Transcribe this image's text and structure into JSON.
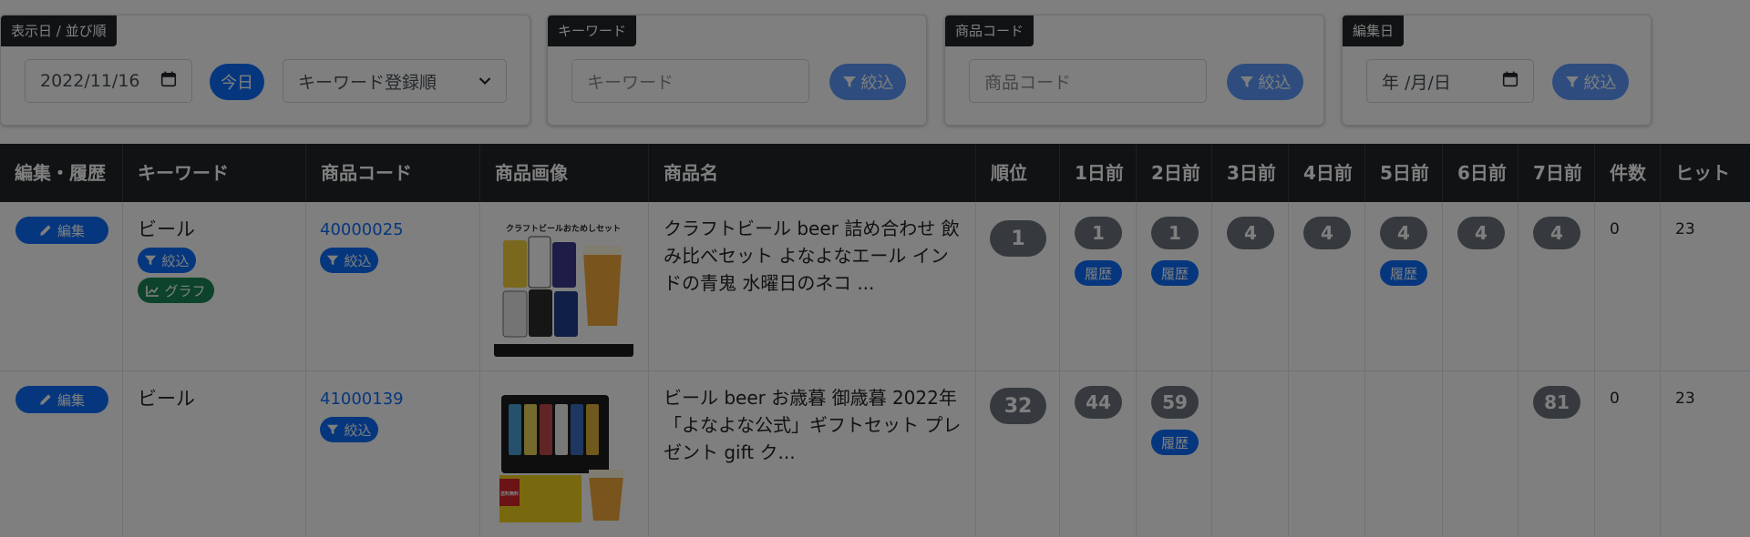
{
  "filters": {
    "date_sort": {
      "tag": "表示日 / 並び順",
      "date_value": "2022/11/16",
      "today_label": "今日",
      "sort_selected": "キーワード登録順"
    },
    "keyword": {
      "tag": "キーワード",
      "placeholder": "キーワード",
      "filter_label": "絞込"
    },
    "product_code": {
      "tag": "商品コード",
      "placeholder": "商品コード",
      "filter_label": "絞込"
    },
    "edit_date": {
      "tag": "編集日",
      "placeholder": "年 /月/日",
      "filter_label": "絞込"
    }
  },
  "table": {
    "headers": [
      "編集・履歴",
      "キーワード",
      "商品コード",
      "商品画像",
      "商品名",
      "順位",
      "1日前",
      "2日前",
      "3日前",
      "4日前",
      "5日前",
      "6日前",
      "7日前",
      "件数",
      "ヒット"
    ],
    "rows": [
      {
        "edit_label": "編集",
        "keyword": "ビール",
        "keyword_filter_label": "絞込",
        "graph_label": "グラフ",
        "code": "40000025",
        "code_filter_label": "絞込",
        "product_name": "クラフトビール beer 詰め合わせ 飲み比べセット よなよなエール インドの青鬼 水曜日のネコ ...",
        "image_text": "クラフトビールおためしセット",
        "rank": "1",
        "days": [
          "1",
          "1",
          "4",
          "4",
          "4",
          "4",
          "4"
        ],
        "history": [
          true,
          true,
          false,
          false,
          true,
          false,
          false
        ],
        "history_label": "履歴",
        "count": "0",
        "hits": "23"
      },
      {
        "edit_label": "編集",
        "keyword": "ビール",
        "code": "41000139",
        "code_filter_label": "絞込",
        "product_name": "ビール beer お歳暮 御歳暮 2022年「よなよな公式」ギフトセット プレゼント gift ク...",
        "image_text": "送料無料",
        "rank": "32",
        "days": [
          "44",
          "59",
          "",
          "",
          "",
          "",
          "81"
        ],
        "history": [
          false,
          true,
          false,
          false,
          false,
          false,
          false
        ],
        "history_label": "履歴",
        "count": "0",
        "hits": "23"
      }
    ]
  },
  "colors": {
    "primary": "#0d6efd",
    "success": "#198754",
    "secondary": "#6c757d",
    "dark": "#212529"
  },
  "icons": {
    "edit": "pencil-icon",
    "filter": "funnel-icon",
    "graph": "chart-line-icon",
    "calendar": "calendar-icon",
    "select": "chevron-down-icon"
  }
}
